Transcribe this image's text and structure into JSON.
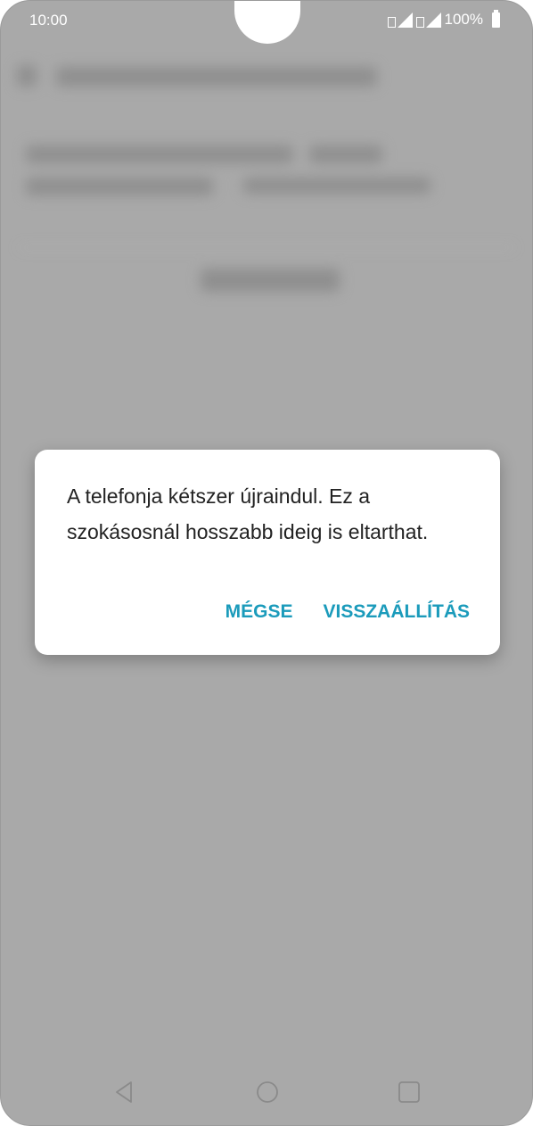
{
  "status_bar": {
    "time": "10:00",
    "battery": "100%",
    "icons": [
      "sim1-signal-icon",
      "sim2-signal-icon",
      "battery-icon"
    ]
  },
  "dialog": {
    "message": "A telefonja kétszer újraindul. Ez a szokásosnál hosszabb ideig is eltarthat.",
    "cancel_label": "MÉGSE",
    "confirm_label": "VISSZAÁLLÍTÁS"
  },
  "nav_bar": {
    "icons": [
      "back-icon",
      "home-icon",
      "recents-icon"
    ]
  },
  "colors": {
    "scrim": "#a9a9a9",
    "accent": "#1b9bbb",
    "dialog_bg": "#ffffff",
    "text": "#222222"
  }
}
